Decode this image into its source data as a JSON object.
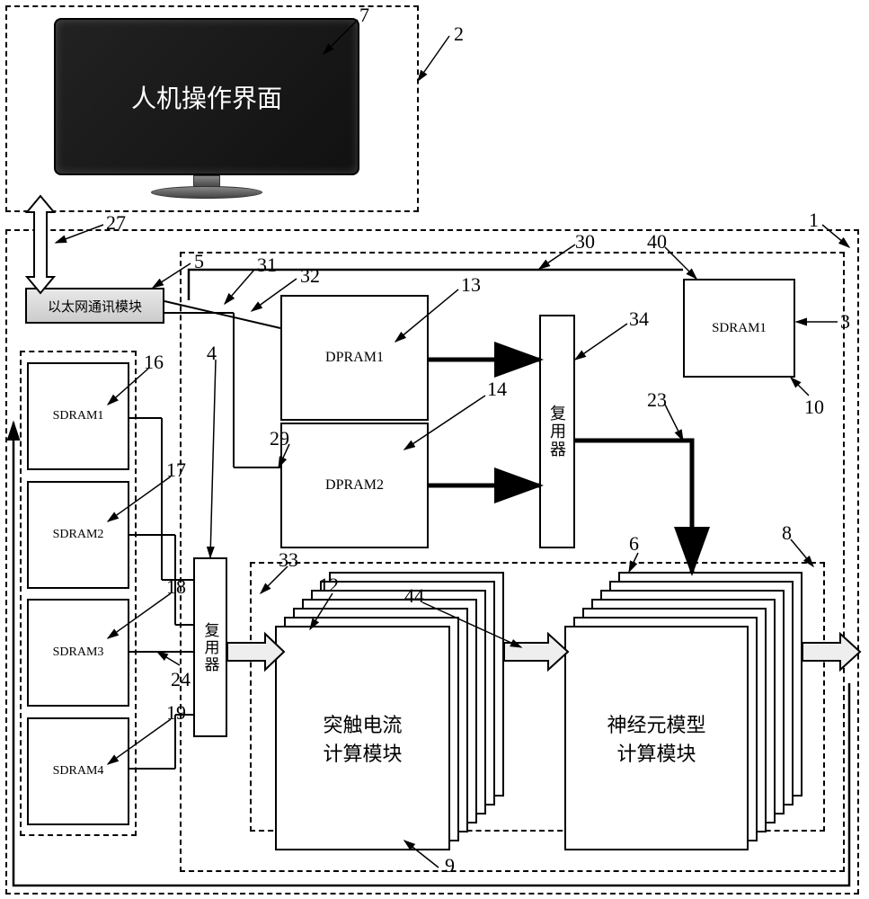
{
  "monitor": {
    "label": "人机操作界面"
  },
  "ethernet": {
    "label": "以太网通讯模块"
  },
  "dpram1": {
    "label": "DPRAM1"
  },
  "dpram2": {
    "label": "DPRAM2"
  },
  "sdram_right": {
    "label": "SDRAM1"
  },
  "mux1": {
    "label": "复用器"
  },
  "mux2": {
    "label": "复用器"
  },
  "sdram_left": {
    "s1": "SDRAM1",
    "s2": "SDRAM2",
    "s3": "SDRAM3",
    "s4": "SDRAM4"
  },
  "synapse": {
    "label": "突触电流\n计算模块"
  },
  "neuron": {
    "label": "神经元模型\n计算模块"
  },
  "refs": {
    "r1": "1",
    "r2": "2",
    "r3": "3",
    "r4": "4",
    "r5": "5",
    "r6": "6",
    "r7": "7",
    "r8": "8",
    "r9": "9",
    "r10": "10",
    "r12": "12",
    "r13": "13",
    "r14": "14",
    "r16": "16",
    "r17": "17",
    "r18": "18",
    "r19": "19",
    "r23": "23",
    "r24": "24",
    "r27": "27",
    "r29": "29",
    "r30": "30",
    "r31": "31",
    "r32": "32",
    "r33": "33",
    "r34": "34",
    "r40": "40",
    "r44": "44"
  }
}
